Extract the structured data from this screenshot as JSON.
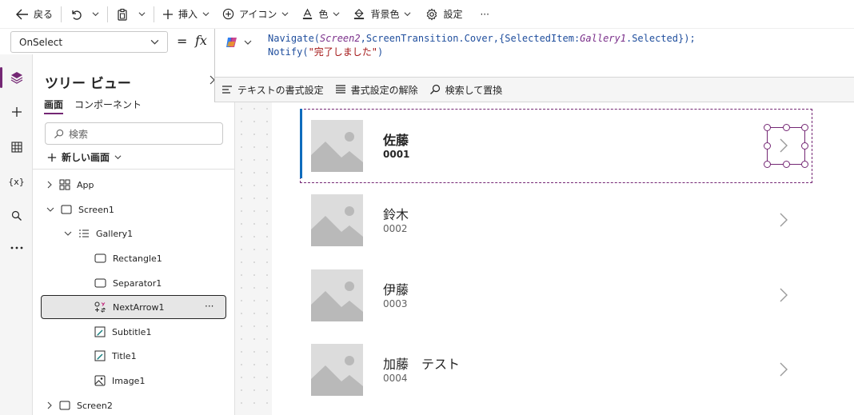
{
  "toolbar": {
    "back": "戻る",
    "insert": "挿入",
    "icon": "アイコン",
    "color": "色",
    "background": "背景色",
    "settings": "設定",
    "more": "···"
  },
  "formula": {
    "property": "OnSelect",
    "eq": "=",
    "fx": "fx",
    "line1": {
      "p1": "Navigate(",
      "screen": "Screen2",
      "p2": ",ScreenTransition.Cover,{",
      "field": "SelectedItem",
      "p3": ":",
      "gallery": "Gallery1",
      "p4": ".Selected});"
    },
    "line2": {
      "fn": "Notify(",
      "str": "\"完了しました\"",
      "close": ")"
    }
  },
  "format_bar": {
    "text_format": "テキストの書式設定",
    "remove_format": "書式設定の解除",
    "find_replace": "検索して置換"
  },
  "tree": {
    "title": "ツリー ビュー",
    "tab_screens": "画面",
    "tab_components": "コンポーネント",
    "search_placeholder": "検索",
    "new_screen": "新しい画面",
    "nodes": [
      "App",
      "Screen1",
      "Gallery1",
      "Rectangle1",
      "Separator1",
      "NextArrow1",
      "Subtitle1",
      "Title1",
      "Image1",
      "Screen2"
    ],
    "node_more": "···"
  },
  "gallery": {
    "items": [
      {
        "title": "佐藤",
        "subtitle": "0001"
      },
      {
        "title": "鈴木",
        "subtitle": "0002"
      },
      {
        "title": "伊藤",
        "subtitle": "0003"
      },
      {
        "title": "加藤　テスト",
        "subtitle": "0004"
      }
    ]
  },
  "colors": {
    "accent": "#742774",
    "selection": "#0f6cbd"
  }
}
